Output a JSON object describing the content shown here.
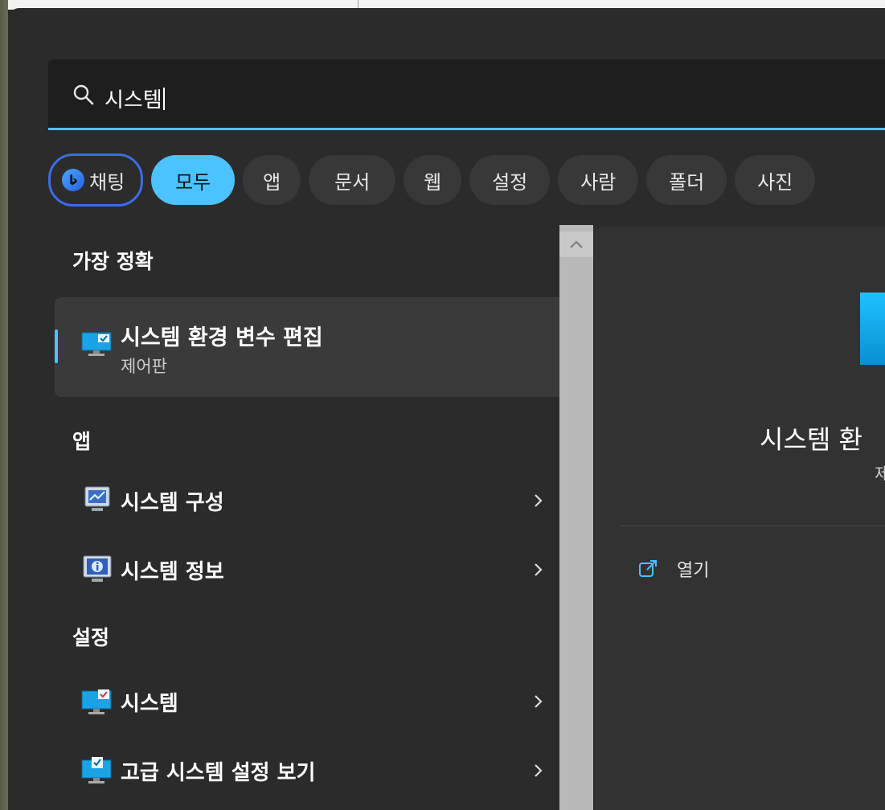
{
  "search": {
    "query": "시스템"
  },
  "filters": [
    {
      "label": "채팅",
      "name": "chip-chat"
    },
    {
      "label": "모두",
      "name": "chip-all"
    },
    {
      "label": "앱",
      "name": "chip-apps"
    },
    {
      "label": "문서",
      "name": "chip-documents"
    },
    {
      "label": "웹",
      "name": "chip-web"
    },
    {
      "label": "설정",
      "name": "chip-settings"
    },
    {
      "label": "사람",
      "name": "chip-people"
    },
    {
      "label": "폴더",
      "name": "chip-folders"
    },
    {
      "label": "사진",
      "name": "chip-photos"
    }
  ],
  "best_match": {
    "heading": "가장 정확",
    "title": "시스템 환경 변수 편집",
    "subtitle": "제어판"
  },
  "apps": {
    "heading": "앱",
    "items": [
      {
        "label": "시스템 구성"
      },
      {
        "label": "시스템 정보"
      }
    ]
  },
  "settings": {
    "heading": "설정",
    "items": [
      {
        "label": "시스템"
      },
      {
        "label": "고급 시스템 설정 보기"
      }
    ]
  },
  "preview": {
    "title": "시스템 환",
    "subtitle": "제",
    "open_label": "열기"
  },
  "colors": {
    "accent": "#4cc2ff",
    "panel": "#2b2b2b"
  }
}
